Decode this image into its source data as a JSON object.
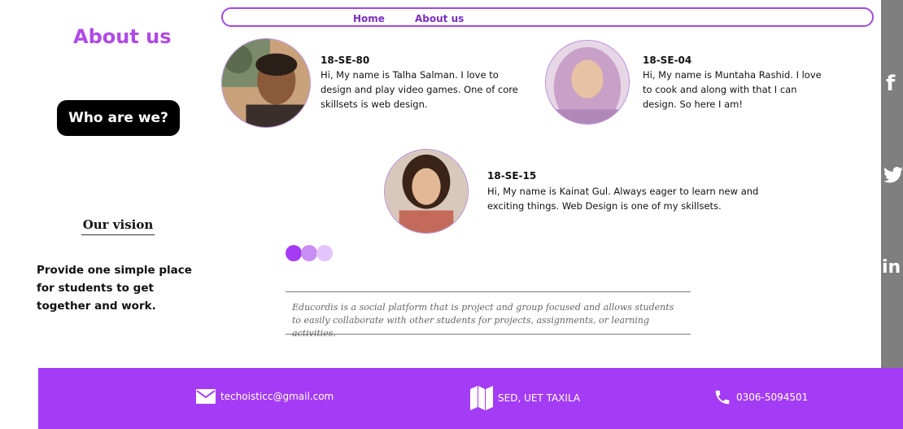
{
  "nav": {
    "home": "Home",
    "about": "About us"
  },
  "page": {
    "title": "About us",
    "who_button": "Who are we?",
    "vision_title": "Our vision",
    "vision_text": "Provide one simple place for students to get together and work."
  },
  "profiles": [
    {
      "id": "18-SE-80",
      "desc": "Hi, My name is Talha Salman. I love to design and play video games. One of core skillsets is web design."
    },
    {
      "id": "18-SE-04",
      "desc": "Hi, My name is Muntaha Rashid. I love to cook and along with that I can design. So here I am!"
    },
    {
      "id": "18-SE-15",
      "desc": "Hi, My name is Kainat Gul. Always eager to learn new and exciting things. Web Design is one of my skillsets."
    }
  ],
  "quote": "Educordis is a social platform that is project and group focused and allows students to easily collaborate with other students for projects, assignments, or learning activities.",
  "social": {
    "facebook": "f",
    "twitter": "twitter-bird-icon",
    "linkedin": "in"
  },
  "footer": {
    "email": "techoisticc@gmail.com",
    "location": "SED, UET TAXILA",
    "phone": "0306-5094501"
  },
  "colors": {
    "accent": "#a43cf5",
    "title": "#b04ae6",
    "nav_border": "#a24ae0",
    "sidebar": "#7f7f7f",
    "dot1": "#a43cf5",
    "dot2": "#c98ef3",
    "dot3": "#e3c4fb"
  }
}
